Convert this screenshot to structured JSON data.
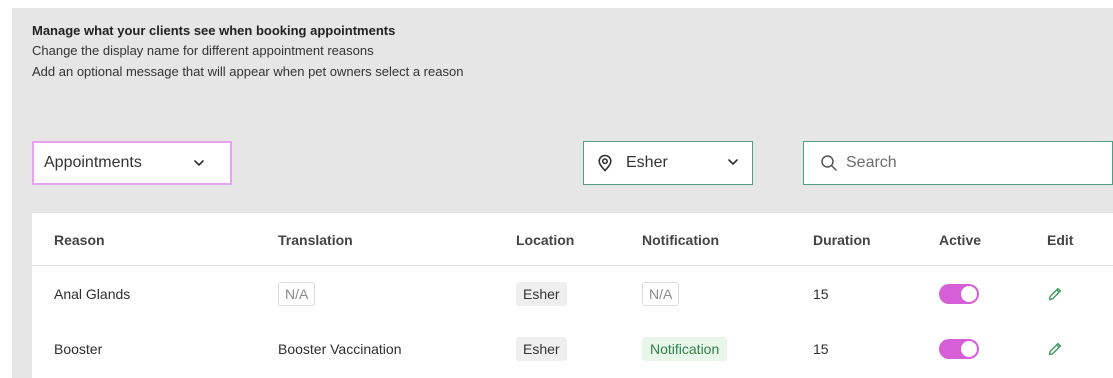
{
  "intro": {
    "title": "Manage what your clients see when booking appointments",
    "line1": "Change the display name for different appointment reasons",
    "line2": "Add an optional message that will appear when pet owners select a reason"
  },
  "filters": {
    "type_selected": "Appointments",
    "location_selected": "Esher",
    "search_placeholder": "Search"
  },
  "table": {
    "headers": {
      "reason": "Reason",
      "translation": "Translation",
      "location": "Location",
      "notification": "Notification",
      "duration": "Duration",
      "active": "Active",
      "edit": "Edit"
    },
    "rows": [
      {
        "reason": "Anal Glands",
        "translation": "N/A",
        "location": "Esher",
        "notification": "N/A",
        "duration": "15",
        "active": true
      },
      {
        "reason": "Booster",
        "translation": "Booster Vaccination",
        "location": "Esher",
        "notification": "Notification",
        "duration": "15",
        "active": true
      }
    ]
  },
  "colors": {
    "accent_pink": "#e8a3ee",
    "toggle_on": "#d65ed6",
    "green_border": "#4f9e83",
    "notification_bg": "#e8f7ea",
    "notification_text": "#2f7f4e",
    "edit_icon": "#3f9a5f"
  },
  "icons": {
    "location": "location-pin-icon",
    "search": "search-icon",
    "dropdown": "chevron-down-icon",
    "edit": "pencil-icon"
  }
}
